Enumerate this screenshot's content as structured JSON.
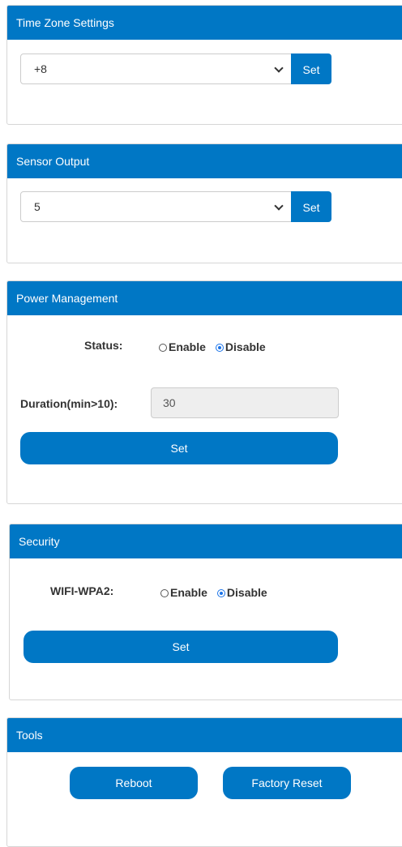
{
  "timezone": {
    "title": "Time Zone Settings",
    "selected": "+8",
    "set_label": "Set"
  },
  "sensor": {
    "title": "Sensor Output",
    "selected": "5",
    "set_label": "Set"
  },
  "power": {
    "title": "Power Management",
    "status_label": "Status:",
    "enable_label": "Enable",
    "disable_label": "Disable",
    "selected_status": "Disable",
    "duration_label": "Duration(min>10):",
    "duration_value": "30",
    "set_label": "Set"
  },
  "security": {
    "title": "Security",
    "wifi_label": "WIFI-WPA2:",
    "enable_label": "Enable",
    "disable_label": "Disable",
    "selected": "Disable",
    "set_label": "Set"
  },
  "tools": {
    "title": "Tools",
    "reboot_label": "Reboot",
    "factory_reset_label": "Factory Reset"
  },
  "colors": {
    "accent": "#0077c5",
    "radio_checked": "#1a73e8"
  }
}
